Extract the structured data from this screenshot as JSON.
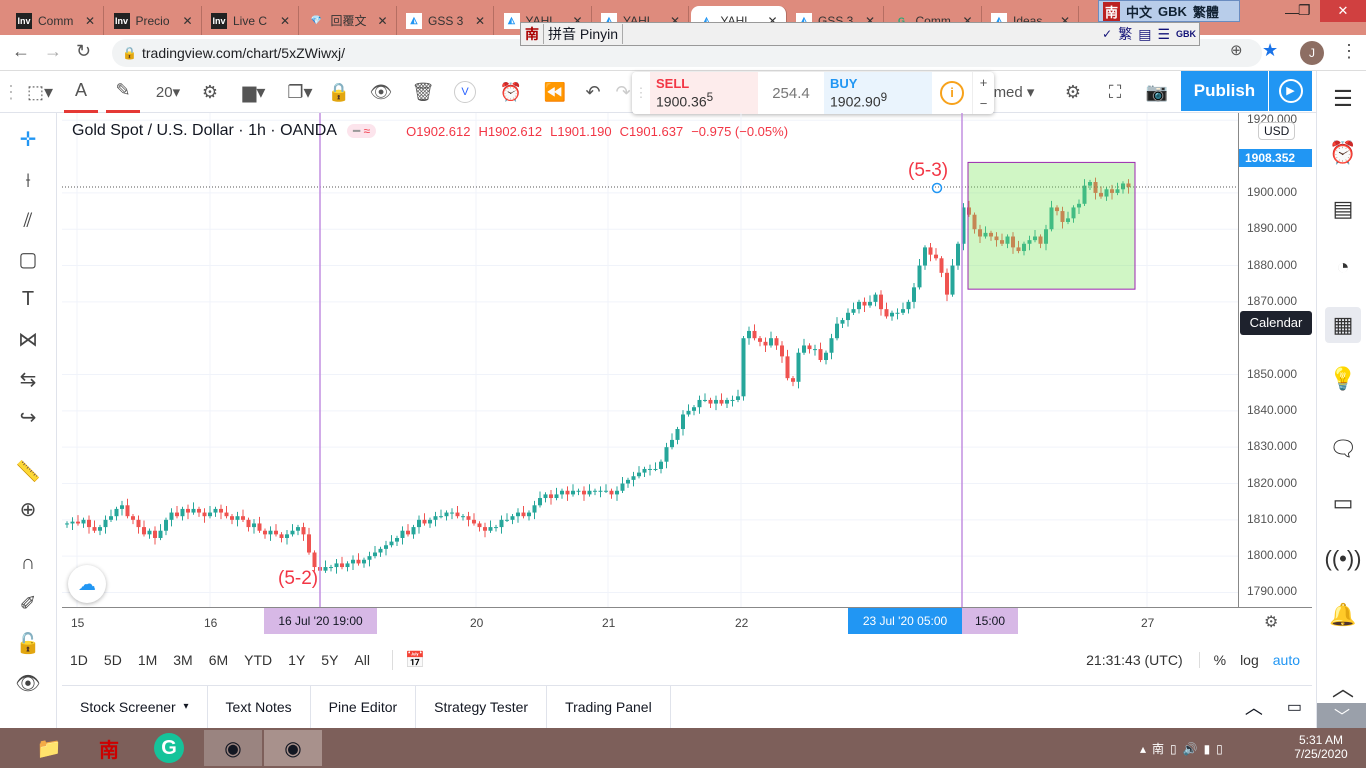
{
  "browser": {
    "tabs": [
      {
        "label": "Comm",
        "icon": "Inv"
      },
      {
        "label": "Precio",
        "icon": "Inv"
      },
      {
        "label": "Live C",
        "icon": "Inv"
      },
      {
        "label": "回覆文",
        "icon": "gem"
      },
      {
        "label": "GSS 3",
        "icon": "tv"
      },
      {
        "label": "YAHL",
        "icon": "tv"
      },
      {
        "label": "YAHL",
        "icon": "tv"
      },
      {
        "label": "YAHL",
        "icon": "tv"
      },
      {
        "label": "GSS 3",
        "icon": "tv"
      },
      {
        "label": "Comm",
        "icon": "g"
      },
      {
        "label": "Ideas",
        "icon": "tv"
      }
    ],
    "active_tab": 7,
    "url": "tradingview.com/chart/5xZWiwxj/",
    "profile_initial": "J"
  },
  "ime": {
    "logo": "南",
    "mode": "拼音 Pinyin",
    "status_bar": [
      "南",
      "中文",
      "GBK",
      "繁體"
    ],
    "buttons": [
      "✓",
      "繁",
      "GBK"
    ]
  },
  "toolbar": {
    "font_size": "20",
    "v_badge": "V",
    "publish": "Publish",
    "interval_partial": "med"
  },
  "trade": {
    "sell_label": "SELL",
    "sell_price": "1900.36",
    "sell_sup": "5",
    "spread": "254.4",
    "buy_label": "BUY",
    "buy_price": "1902.90",
    "buy_sup": "9"
  },
  "legend": {
    "symbol": "Gold Spot / U.S. Dollar · 1h · OANDA",
    "open": "O1902.612",
    "high": "H1902.612",
    "low": "L1901.190",
    "close": "C1901.637",
    "change": "−0.975 (−0.05%)"
  },
  "annotations": {
    "a1": "(5-2)",
    "a2": "(5-3)"
  },
  "tooltip": "Calendar",
  "price_axis": {
    "currency": "USD",
    "current": "1908.352",
    "labels": [
      "1920.000",
      "1900.000",
      "1890.000",
      "1880.000",
      "1870.000",
      "1850.000",
      "1840.000",
      "1830.000",
      "1820.000",
      "1810.000",
      "1800.000",
      "1790.000"
    ]
  },
  "time_axis": {
    "labels": [
      "15",
      "16",
      "20",
      "21",
      "22",
      "27"
    ],
    "cursor1": "16 Jul '20   19:00",
    "cursor2": "23 Jul '20   05:00",
    "cursor3": "15:00"
  },
  "ranges": [
    "1D",
    "5D",
    "1M",
    "3M",
    "6M",
    "YTD",
    "1Y",
    "5Y",
    "All"
  ],
  "clock": "21:31:43 (UTC)",
  "scale": [
    "%",
    "log",
    "auto"
  ],
  "bottom_tabs": [
    "Stock Screener",
    "Text Notes",
    "Pine Editor",
    "Strategy Tester",
    "Trading Panel"
  ],
  "taskbar": {
    "time": "5:31 AM",
    "date": "7/25/2020"
  },
  "colors": {
    "up": "#26a69a",
    "down": "#ef5350",
    "accent": "#2196f3"
  },
  "chart_data": {
    "type": "candlestick",
    "title": "Gold Spot / U.S. Dollar 1h OANDA",
    "ylim": [
      1786,
      1922
    ],
    "interval": "1h",
    "first_open": 1809,
    "closes": [
      1809,
      1809.5,
      1809,
      1810,
      1808,
      1807,
      1808,
      1810,
      1811,
      1813,
      1814,
      1811,
      1810,
      1808,
      1806,
      1807,
      1805,
      1807,
      1810,
      1812,
      1811,
      1813,
      1812,
      1813,
      1812,
      1811,
      1812,
      1813,
      1812,
      1811,
      1810,
      1811,
      1810,
      1808,
      1809,
      1807,
      1806,
      1807,
      1806,
      1805,
      1806,
      1807,
      1808,
      1806,
      1801,
      1797,
      1796,
      1797,
      1797,
      1798,
      1797,
      1798,
      1799,
      1798,
      1799,
      1800,
      1801,
      1802,
      1803,
      1804,
      1805,
      1807,
      1806,
      1808,
      1810,
      1809,
      1810,
      1811,
      1811,
      1812,
      1812,
      1811,
      1811,
      1810,
      1809,
      1808,
      1807,
      1808,
      1808,
      1810,
      1810,
      1811,
      1812,
      1811,
      1812,
      1814,
      1816,
      1817,
      1816,
      1817,
      1818,
      1817,
      1818,
      1818,
      1817,
      1818,
      1818,
      1818,
      1818,
      1817,
      1818,
      1820,
      1821,
      1822,
      1823,
      1824,
      1824,
      1824,
      1826,
      1830,
      1832,
      1835,
      1839,
      1840,
      1841,
      1843,
      1843,
      1842,
      1843,
      1842,
      1843,
      1843,
      1844,
      1860,
      1862,
      1860,
      1859,
      1858,
      1860,
      1858,
      1855,
      1849,
      1848,
      1856,
      1858,
      1857,
      1857,
      1854,
      1856,
      1860,
      1864,
      1865,
      1867,
      1868,
      1870,
      1869,
      1870,
      1872,
      1868,
      1866,
      1867,
      1867,
      1868,
      1870,
      1874,
      1880,
      1885,
      1883,
      1882,
      1878,
      1872,
      1880,
      1886,
      1896,
      1894,
      1890,
      1888,
      1889,
      1888,
      1887,
      1886,
      1888,
      1885,
      1884,
      1886,
      1887,
      1888,
      1886,
      1890,
      1896,
      1895,
      1892,
      1893,
      1896,
      1897,
      1902,
      1903,
      1900,
      1899,
      1901,
      1900,
      1901,
      1902.6,
      1901.6
    ],
    "last_close": 1901.637,
    "box": {
      "price_top": 1908.4,
      "price_bottom": 1873.5
    }
  }
}
